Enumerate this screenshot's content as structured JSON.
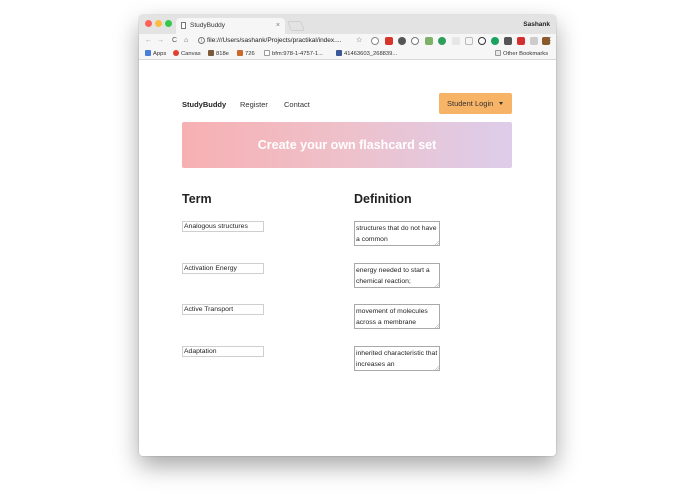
{
  "browser": {
    "tab_title": "StudyBuddy",
    "tab_close": "×",
    "profile_name": "Sashank",
    "nav_back": "←",
    "nav_forward": "→",
    "nav_reload": "C",
    "nav_home": "⌂",
    "address": "file:///Users/sashank/Projects/practikal/index....",
    "star": "☆",
    "menu": "⋮",
    "bookmarks": [
      {
        "label": "Apps",
        "color": "#4a7fd9"
      },
      {
        "label": "Canvas",
        "color": "#e03e2f"
      },
      {
        "label": "818e",
        "color": "#7a5a3a"
      },
      {
        "label": "726",
        "color": "#c96b2c"
      },
      {
        "label": "bfm:978-1-4757-1...",
        "color": "#9a9a9a"
      },
      {
        "label": "41463603_268839...",
        "color": "#3b5998"
      }
    ],
    "other_bookmarks": "Other Bookmarks"
  },
  "navbar": {
    "brand": "StudyBuddy",
    "links": [
      "Register",
      "Contact"
    ],
    "login_label": "Student Login"
  },
  "banner": {
    "text": "Create your own flashcard set"
  },
  "columns": {
    "term": "Term",
    "definition": "Definition"
  },
  "cards": [
    {
      "term": "Analogous structures",
      "definition": "structures that do not have a common"
    },
    {
      "term": "Activation Energy",
      "definition": "energy needed to start a chemical reaction;"
    },
    {
      "term": "Active Transport",
      "definition": "movement of molecules across a membrane"
    },
    {
      "term": "Adaptation",
      "definition": "inherited characteristic that increases an"
    }
  ],
  "colors": {
    "login_button": "#f7b366",
    "banner_start": "#f7b0b2",
    "banner_end": "#ddcdeb"
  }
}
